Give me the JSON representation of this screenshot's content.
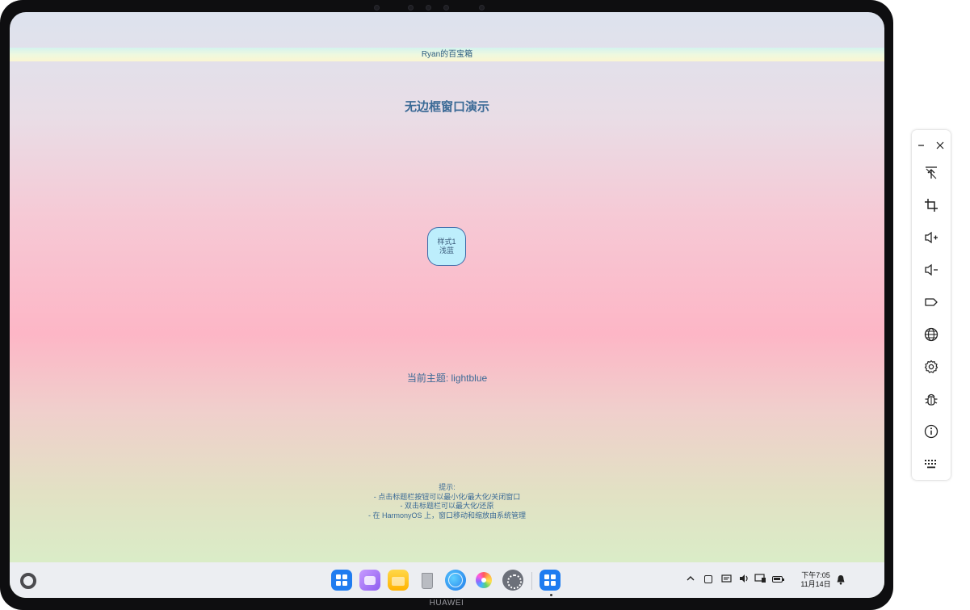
{
  "window": {
    "title_bar_text": "Ryan的百宝箱"
  },
  "main": {
    "page_title": "无边框窗口演示",
    "style_button": {
      "line1": "样式1",
      "line2": "浅蓝"
    },
    "current_theme_text": "当前主题: lightblue",
    "tips": [
      "提示:",
      "- 点击标题栏按钮可以最小化/最大化/关闭窗口",
      "- 双击标题栏可以最大化/还原",
      "- 在 HarmonyOS 上，窗口移动和缩放由系统管理"
    ]
  },
  "dock": {
    "apps": [
      {
        "name": "app-center-icon",
        "style": "grid-blue"
      },
      {
        "name": "multi-window-icon",
        "style": "purple"
      },
      {
        "name": "files-icon",
        "style": "folder"
      },
      {
        "name": "trash-icon",
        "style": "trash"
      },
      {
        "name": "browser-icon",
        "style": "browser"
      },
      {
        "name": "gallery-icon",
        "style": "photos"
      },
      {
        "name": "settings-icon",
        "style": "settings"
      }
    ],
    "running_app": {
      "name": "running-app-icon",
      "style": "grid-blue"
    },
    "clock": {
      "time": "下午7:05",
      "date": "11月14日"
    }
  },
  "device": {
    "brand": "HUAWEI"
  },
  "toolbar": {
    "buttons": [
      "clear-pin-icon",
      "crop-icon",
      "volume-up-icon",
      "volume-down-icon",
      "label-tag-icon",
      "globe-icon",
      "gear-icon",
      "bug-icon",
      "info-icon",
      "keyboard-icon"
    ]
  },
  "colors": {
    "accent_text": "#3b6a96",
    "button_fill": "#bdeefc",
    "button_border": "#3d6aa8"
  }
}
